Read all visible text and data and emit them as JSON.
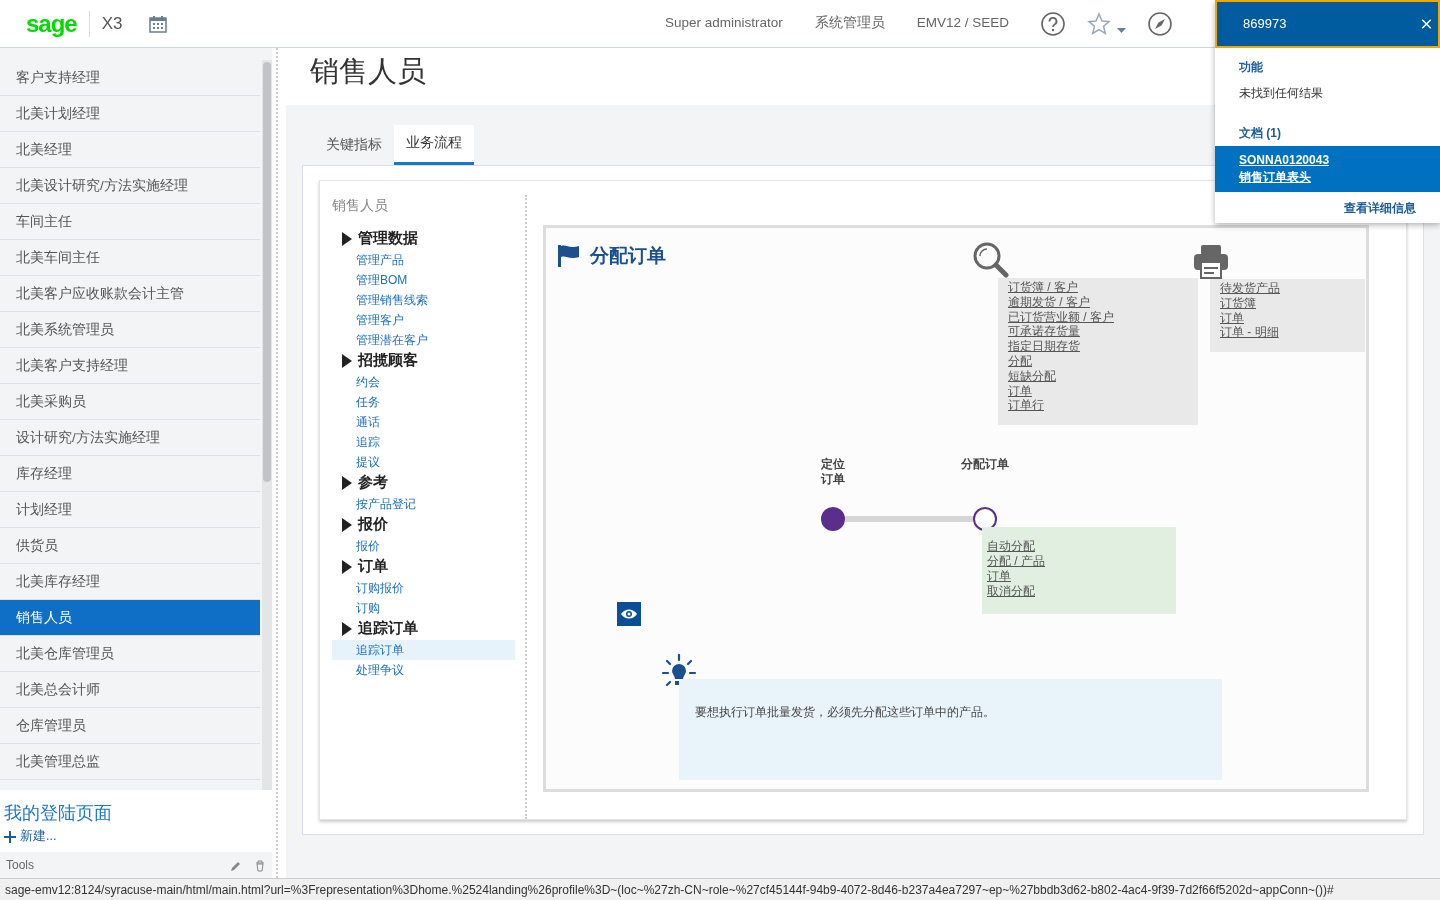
{
  "header": {
    "logo": "sage",
    "product": "X3",
    "user": "Super administrator",
    "role": "系统管理员",
    "folder": "EMV12 / SEED"
  },
  "search": {
    "value": "869973",
    "sections": [
      {
        "title": "功能",
        "items": [
          {
            "kind": "message",
            "text": "未找到任何结果"
          }
        ]
      },
      {
        "title": "文档 (1)",
        "items": [
          {
            "kind": "result",
            "code": "SONNA0120043",
            "text": "销售订单表头",
            "selected": true
          }
        ]
      }
    ],
    "more": "查看详细信息"
  },
  "sidebar": {
    "items": [
      {
        "label": "客户支持经理",
        "selected": false
      },
      {
        "label": "北美计划经理",
        "selected": false
      },
      {
        "label": "北美经理",
        "selected": false
      },
      {
        "label": "北美设计研究/方法实施经理",
        "selected": false
      },
      {
        "label": "车间主任",
        "selected": false
      },
      {
        "label": "北美车间主任",
        "selected": false
      },
      {
        "label": "北美客户应收账款会计主管",
        "selected": false
      },
      {
        "label": "北美系统管理员",
        "selected": false
      },
      {
        "label": "北美客户支持经理",
        "selected": false
      },
      {
        "label": "北美采购员",
        "selected": false
      },
      {
        "label": "设计研究/方法实施经理",
        "selected": false
      },
      {
        "label": "库存经理",
        "selected": false
      },
      {
        "label": "计划经理",
        "selected": false
      },
      {
        "label": "供货员",
        "selected": false
      },
      {
        "label": "北美库存经理",
        "selected": false
      },
      {
        "label": "销售人员",
        "selected": true
      },
      {
        "label": "北美仓库管理员",
        "selected": false
      },
      {
        "label": "北美总会计师",
        "selected": false
      },
      {
        "label": "仓库管理员",
        "selected": false
      },
      {
        "label": "北美管理总监",
        "selected": false
      }
    ],
    "landing": "我的登陆页面",
    "new": "新建...",
    "tools": "Tools"
  },
  "page_title": "销售人员",
  "tabs": [
    {
      "label": "关键指标",
      "selected": false
    },
    {
      "label": "业务流程",
      "selected": true
    }
  ],
  "panel_title": "销售人员",
  "tree": [
    {
      "label": "管理数据",
      "children": [
        {
          "label": "管理产品",
          "selected": false
        },
        {
          "label": "管理BOM",
          "selected": false
        },
        {
          "label": "管理销售线索",
          "selected": false
        },
        {
          "label": "管理客户",
          "selected": false
        },
        {
          "label": "管理潜在客户",
          "selected": false
        }
      ]
    },
    {
      "label": "招揽顾客",
      "children": [
        {
          "label": "约会",
          "selected": false
        },
        {
          "label": "任务",
          "selected": false
        },
        {
          "label": "通话",
          "selected": false
        },
        {
          "label": "追踪",
          "selected": false
        },
        {
          "label": "提议",
          "selected": false
        }
      ]
    },
    {
      "label": "参考",
      "children": [
        {
          "label": "按产品登记",
          "selected": false
        }
      ]
    },
    {
      "label": "报价",
      "children": [
        {
          "label": "报价",
          "selected": false
        }
      ]
    },
    {
      "label": "订单",
      "children": [
        {
          "label": "订购报价",
          "selected": false
        },
        {
          "label": "订购",
          "selected": false
        }
      ]
    },
    {
      "label": "追踪订单",
      "children": [
        {
          "label": "追踪订单",
          "selected": true
        },
        {
          "label": "处理争议",
          "selected": false
        }
      ]
    }
  ],
  "diagram": {
    "title": "分配订单",
    "inquiry_links": [
      "订货簿 / 客户",
      "逾期发货 / 客户",
      "已订货营业额 / 客户",
      "可承诺存货量",
      "指定日期存货",
      "分配",
      "短缺分配",
      "订单",
      "订单行"
    ],
    "report_links": [
      "待发货产品",
      "订货簿",
      "订单",
      "订单 - 明细"
    ],
    "steps": [
      {
        "label_lines": [
          "定位",
          "订单"
        ],
        "completed": true
      },
      {
        "label_lines": [
          "分配订单"
        ],
        "completed": false
      }
    ],
    "step_links": [
      "自动分配",
      "分配 / 产品",
      "订单",
      "取消分配"
    ],
    "tip": "要想执行订单批量发货，必须先分配这些订单中的产品。"
  },
  "status_bar": "sage-emv12:8124/syracuse-main/html/main.html?url=%3Frepresentation%3Dhome.%2524landing%26profile%3D~(loc~%27zh-CN~role~%27cf45144f-94b9-4072-8d46-b237a4ea7297~ep~%27bbdb3d62-b802-4ac4-9f39-7d2f66f5202d~appConn~())#"
}
